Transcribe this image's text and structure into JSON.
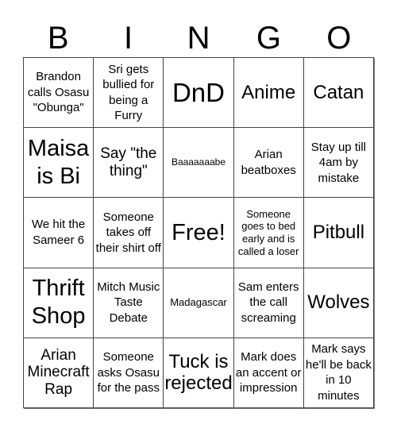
{
  "header": {
    "letters": [
      "B",
      "I",
      "N",
      "G",
      "O"
    ]
  },
  "board": {
    "rows": [
      [
        "Brandon calls Osasu \"Obunga\"",
        "Sri gets bullied for being a Furry",
        "DnD",
        "Anime",
        "Catan"
      ],
      [
        "Maisa is Bi",
        "Say \"the thing\"",
        "Baaaaaaabe",
        "Arian beatboxes",
        "Stay up till 4am by mistake"
      ],
      [
        "We hit the Sameer 6",
        "Someone takes off their shirt off",
        "Free!",
        "Someone goes to bed early and is called a loser",
        "Pitbull"
      ],
      [
        "Thrift Shop",
        "Mitch Music Taste Debate",
        "Madagascar",
        "Sam enters the call screaming",
        "Wolves"
      ],
      [
        "Arian Minecraft Rap",
        "Someone asks Osasu for the pass",
        "Tuck is rejected",
        "Mark does an accent or impression",
        "Mark says he'll be back in 10 minutes"
      ]
    ],
    "free_space": "Free!"
  }
}
